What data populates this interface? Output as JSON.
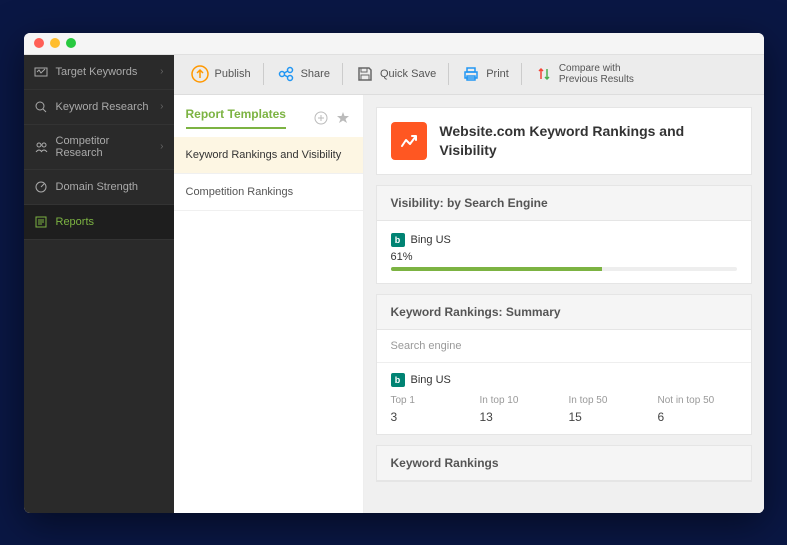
{
  "sidebar": {
    "items": [
      {
        "label": "Target Keywords",
        "has_submenu": true
      },
      {
        "label": "Keyword Research",
        "has_submenu": true
      },
      {
        "label": "Competitor Research",
        "has_submenu": true
      },
      {
        "label": "Domain Strength",
        "has_submenu": false
      },
      {
        "label": "Reports",
        "has_submenu": false
      }
    ]
  },
  "toolbar": {
    "publish": "Publish",
    "share": "Share",
    "quick_save": "Quick Save",
    "print": "Print",
    "compare_line1": "Compare with",
    "compare_line2": "Previous Results"
  },
  "templates": {
    "header": "Report Templates",
    "items": [
      {
        "label": "Keyword Rankings and Visibility"
      },
      {
        "label": "Competition Rankings"
      }
    ]
  },
  "report": {
    "title": "Website.com Keyword Rankings and Visibility",
    "visibility_section": {
      "title": "Visibility: by Search Engine",
      "engine": "Bing US",
      "percent_label": "61%",
      "percent_value": 61
    },
    "summary_section": {
      "title": "Keyword Rankings: Summary",
      "subhead": "Search engine",
      "engine": "Bing US",
      "columns": [
        "Top 1",
        "In top 10",
        "In top 50",
        "Not in top 50"
      ],
      "values": [
        "3",
        "13",
        "15",
        "6"
      ]
    },
    "rankings_section": {
      "title": "Keyword Rankings"
    }
  }
}
